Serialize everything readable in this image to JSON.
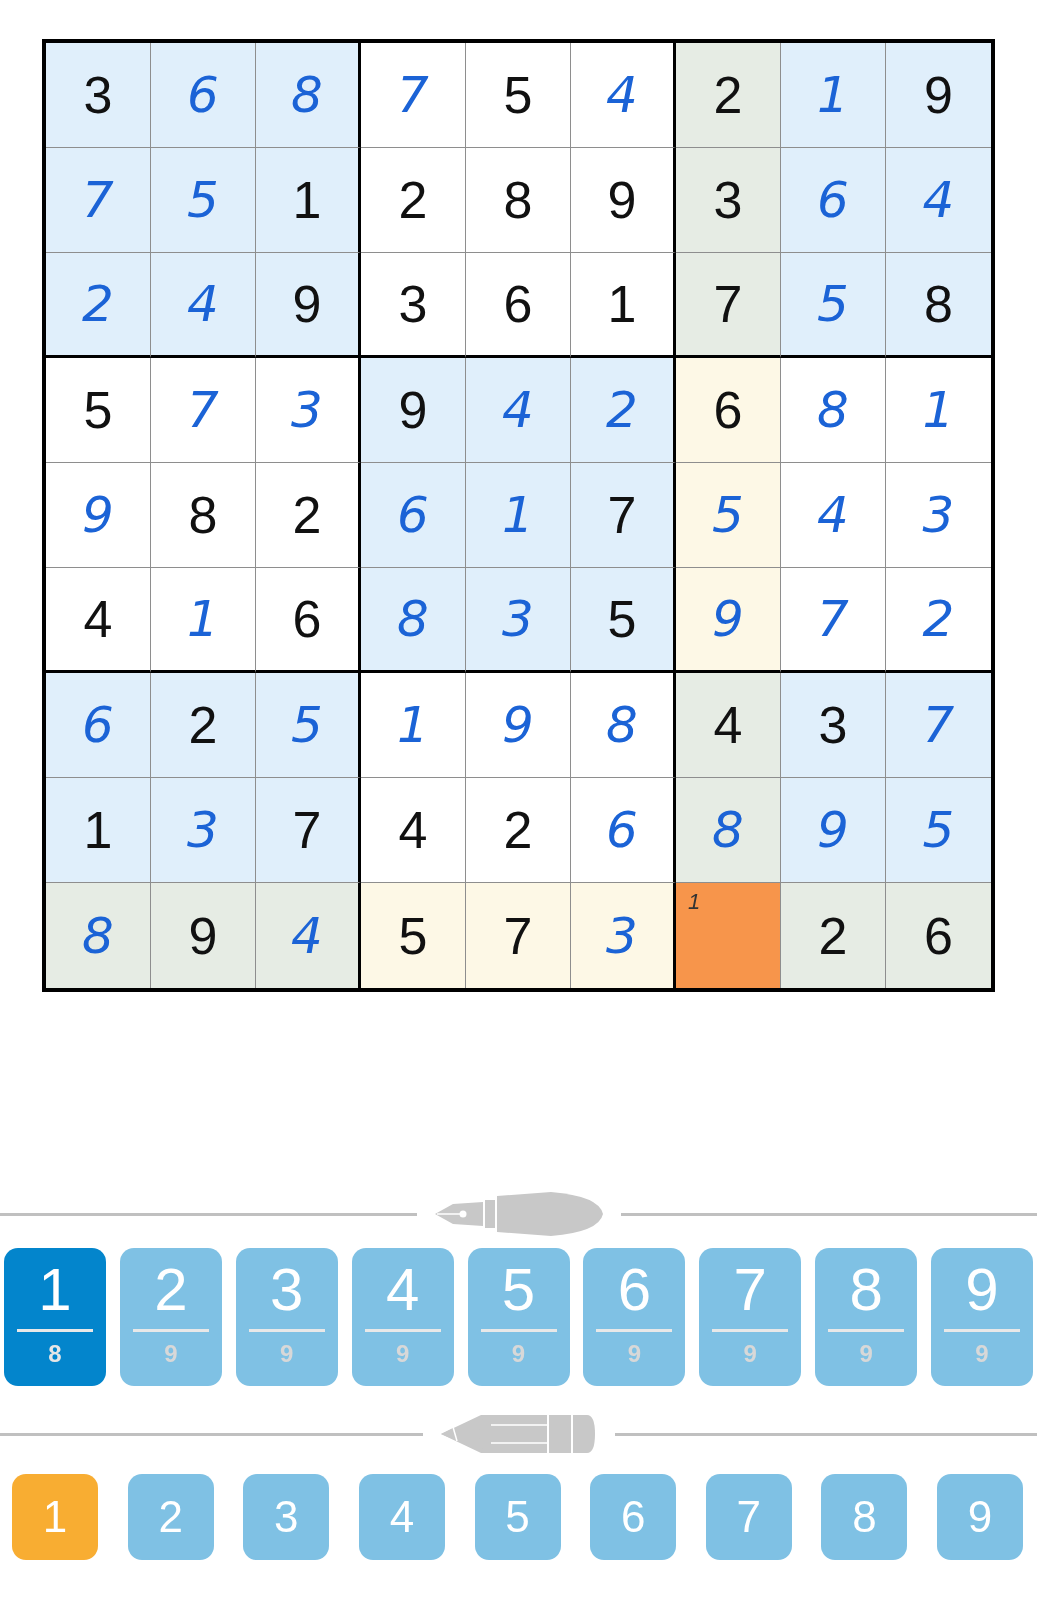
{
  "grid": [
    [
      {
        "value": "3",
        "given": true,
        "kind": "highlight",
        "selected": false
      },
      {
        "value": "6",
        "given": false,
        "kind": "highlight",
        "selected": false
      },
      {
        "value": "8",
        "given": false,
        "kind": "highlight",
        "selected": false
      },
      {
        "value": "7",
        "given": false,
        "kind": "plain",
        "selected": false
      },
      {
        "value": "5",
        "given": true,
        "kind": "plain",
        "selected": false
      },
      {
        "value": "4",
        "given": false,
        "kind": "plain",
        "selected": false
      },
      {
        "value": "2",
        "given": true,
        "kind": "overlap",
        "selected": false
      },
      {
        "value": "1",
        "given": false,
        "kind": "highlight",
        "selected": false
      },
      {
        "value": "9",
        "given": true,
        "kind": "highlight",
        "selected": false
      }
    ],
    [
      {
        "value": "7",
        "given": false,
        "kind": "highlight",
        "selected": false
      },
      {
        "value": "5",
        "given": false,
        "kind": "highlight",
        "selected": false
      },
      {
        "value": "1",
        "given": true,
        "kind": "highlight",
        "selected": false
      },
      {
        "value": "2",
        "given": true,
        "kind": "plain",
        "selected": false
      },
      {
        "value": "8",
        "given": true,
        "kind": "plain",
        "selected": false
      },
      {
        "value": "9",
        "given": true,
        "kind": "plain",
        "selected": false
      },
      {
        "value": "3",
        "given": true,
        "kind": "overlap",
        "selected": false
      },
      {
        "value": "6",
        "given": false,
        "kind": "highlight",
        "selected": false
      },
      {
        "value": "4",
        "given": false,
        "kind": "highlight",
        "selected": false
      }
    ],
    [
      {
        "value": "2",
        "given": false,
        "kind": "highlight",
        "selected": false
      },
      {
        "value": "4",
        "given": false,
        "kind": "highlight",
        "selected": false
      },
      {
        "value": "9",
        "given": true,
        "kind": "highlight",
        "selected": false
      },
      {
        "value": "3",
        "given": true,
        "kind": "plain",
        "selected": false
      },
      {
        "value": "6",
        "given": true,
        "kind": "plain",
        "selected": false
      },
      {
        "value": "1",
        "given": true,
        "kind": "plain",
        "selected": false
      },
      {
        "value": "7",
        "given": true,
        "kind": "overlap",
        "selected": false
      },
      {
        "value": "5",
        "given": false,
        "kind": "highlight",
        "selected": false
      },
      {
        "value": "8",
        "given": true,
        "kind": "highlight",
        "selected": false
      }
    ],
    [
      {
        "value": "5",
        "given": true,
        "kind": "plain",
        "selected": false
      },
      {
        "value": "7",
        "given": false,
        "kind": "plain",
        "selected": false
      },
      {
        "value": "3",
        "given": false,
        "kind": "plain",
        "selected": false
      },
      {
        "value": "9",
        "given": true,
        "kind": "highlight",
        "selected": false
      },
      {
        "value": "4",
        "given": false,
        "kind": "highlight",
        "selected": false
      },
      {
        "value": "2",
        "given": false,
        "kind": "highlight",
        "selected": false
      },
      {
        "value": "6",
        "given": true,
        "kind": "peer",
        "selected": false
      },
      {
        "value": "8",
        "given": false,
        "kind": "plain",
        "selected": false
      },
      {
        "value": "1",
        "given": false,
        "kind": "plain",
        "selected": false
      }
    ],
    [
      {
        "value": "9",
        "given": false,
        "kind": "plain",
        "selected": false
      },
      {
        "value": "8",
        "given": true,
        "kind": "plain",
        "selected": false
      },
      {
        "value": "2",
        "given": true,
        "kind": "plain",
        "selected": false
      },
      {
        "value": "6",
        "given": false,
        "kind": "highlight",
        "selected": false
      },
      {
        "value": "1",
        "given": false,
        "kind": "highlight",
        "selected": false
      },
      {
        "value": "7",
        "given": true,
        "kind": "highlight",
        "selected": false
      },
      {
        "value": "5",
        "given": false,
        "kind": "peer",
        "selected": false
      },
      {
        "value": "4",
        "given": false,
        "kind": "plain",
        "selected": false
      },
      {
        "value": "3",
        "given": false,
        "kind": "plain",
        "selected": false
      }
    ],
    [
      {
        "value": "4",
        "given": true,
        "kind": "plain",
        "selected": false
      },
      {
        "value": "1",
        "given": false,
        "kind": "plain",
        "selected": false
      },
      {
        "value": "6",
        "given": true,
        "kind": "plain",
        "selected": false
      },
      {
        "value": "8",
        "given": false,
        "kind": "highlight",
        "selected": false
      },
      {
        "value": "3",
        "given": false,
        "kind": "highlight",
        "selected": false
      },
      {
        "value": "5",
        "given": true,
        "kind": "highlight",
        "selected": false
      },
      {
        "value": "9",
        "given": false,
        "kind": "peer",
        "selected": false
      },
      {
        "value": "7",
        "given": false,
        "kind": "plain",
        "selected": false
      },
      {
        "value": "2",
        "given": false,
        "kind": "plain",
        "selected": false
      }
    ],
    [
      {
        "value": "6",
        "given": false,
        "kind": "highlight",
        "selected": false
      },
      {
        "value": "2",
        "given": true,
        "kind": "highlight",
        "selected": false
      },
      {
        "value": "5",
        "given": false,
        "kind": "highlight",
        "selected": false
      },
      {
        "value": "1",
        "given": false,
        "kind": "plain",
        "selected": false
      },
      {
        "value": "9",
        "given": false,
        "kind": "plain",
        "selected": false
      },
      {
        "value": "8",
        "given": false,
        "kind": "plain",
        "selected": false
      },
      {
        "value": "4",
        "given": true,
        "kind": "overlap",
        "selected": false
      },
      {
        "value": "3",
        "given": true,
        "kind": "highlight",
        "selected": false
      },
      {
        "value": "7",
        "given": false,
        "kind": "highlight",
        "selected": false
      }
    ],
    [
      {
        "value": "1",
        "given": true,
        "kind": "highlight",
        "selected": false
      },
      {
        "value": "3",
        "given": false,
        "kind": "highlight",
        "selected": false
      },
      {
        "value": "7",
        "given": true,
        "kind": "highlight",
        "selected": false
      },
      {
        "value": "4",
        "given": true,
        "kind": "plain",
        "selected": false
      },
      {
        "value": "2",
        "given": true,
        "kind": "plain",
        "selected": false
      },
      {
        "value": "6",
        "given": false,
        "kind": "plain",
        "selected": false
      },
      {
        "value": "8",
        "given": false,
        "kind": "overlap",
        "selected": false
      },
      {
        "value": "9",
        "given": false,
        "kind": "highlight",
        "selected": false
      },
      {
        "value": "5",
        "given": false,
        "kind": "highlight",
        "selected": false
      }
    ],
    [
      {
        "value": "8",
        "given": false,
        "kind": "overlap",
        "selected": false
      },
      {
        "value": "9",
        "given": true,
        "kind": "overlap",
        "selected": false
      },
      {
        "value": "4",
        "given": false,
        "kind": "overlap",
        "selected": false
      },
      {
        "value": "5",
        "given": true,
        "kind": "peer",
        "selected": false
      },
      {
        "value": "7",
        "given": true,
        "kind": "peer",
        "selected": false
      },
      {
        "value": "3",
        "given": false,
        "kind": "peer",
        "selected": false
      },
      {
        "notes": [
          "1"
        ],
        "selected": true
      },
      {
        "value": "2",
        "given": true,
        "kind": "overlap",
        "selected": false
      },
      {
        "value": "6",
        "given": true,
        "kind": "overlap",
        "selected": false
      }
    ]
  ],
  "pen_keys": [
    {
      "digit": "1",
      "count": "8",
      "selected": true
    },
    {
      "digit": "2",
      "count": "9",
      "selected": false
    },
    {
      "digit": "3",
      "count": "9",
      "selected": false
    },
    {
      "digit": "4",
      "count": "9",
      "selected": false
    },
    {
      "digit": "5",
      "count": "9",
      "selected": false
    },
    {
      "digit": "6",
      "count": "9",
      "selected": false
    },
    {
      "digit": "7",
      "count": "9",
      "selected": false
    },
    {
      "digit": "8",
      "count": "9",
      "selected": false
    },
    {
      "digit": "9",
      "count": "9",
      "selected": false
    }
  ],
  "pencil_keys": [
    {
      "digit": "1",
      "selected": true
    },
    {
      "digit": "2",
      "selected": false
    },
    {
      "digit": "3",
      "selected": false
    },
    {
      "digit": "4",
      "selected": false
    },
    {
      "digit": "5",
      "selected": false
    },
    {
      "digit": "6",
      "selected": false
    },
    {
      "digit": "7",
      "selected": false
    },
    {
      "digit": "8",
      "selected": false
    },
    {
      "digit": "9",
      "selected": false
    }
  ]
}
